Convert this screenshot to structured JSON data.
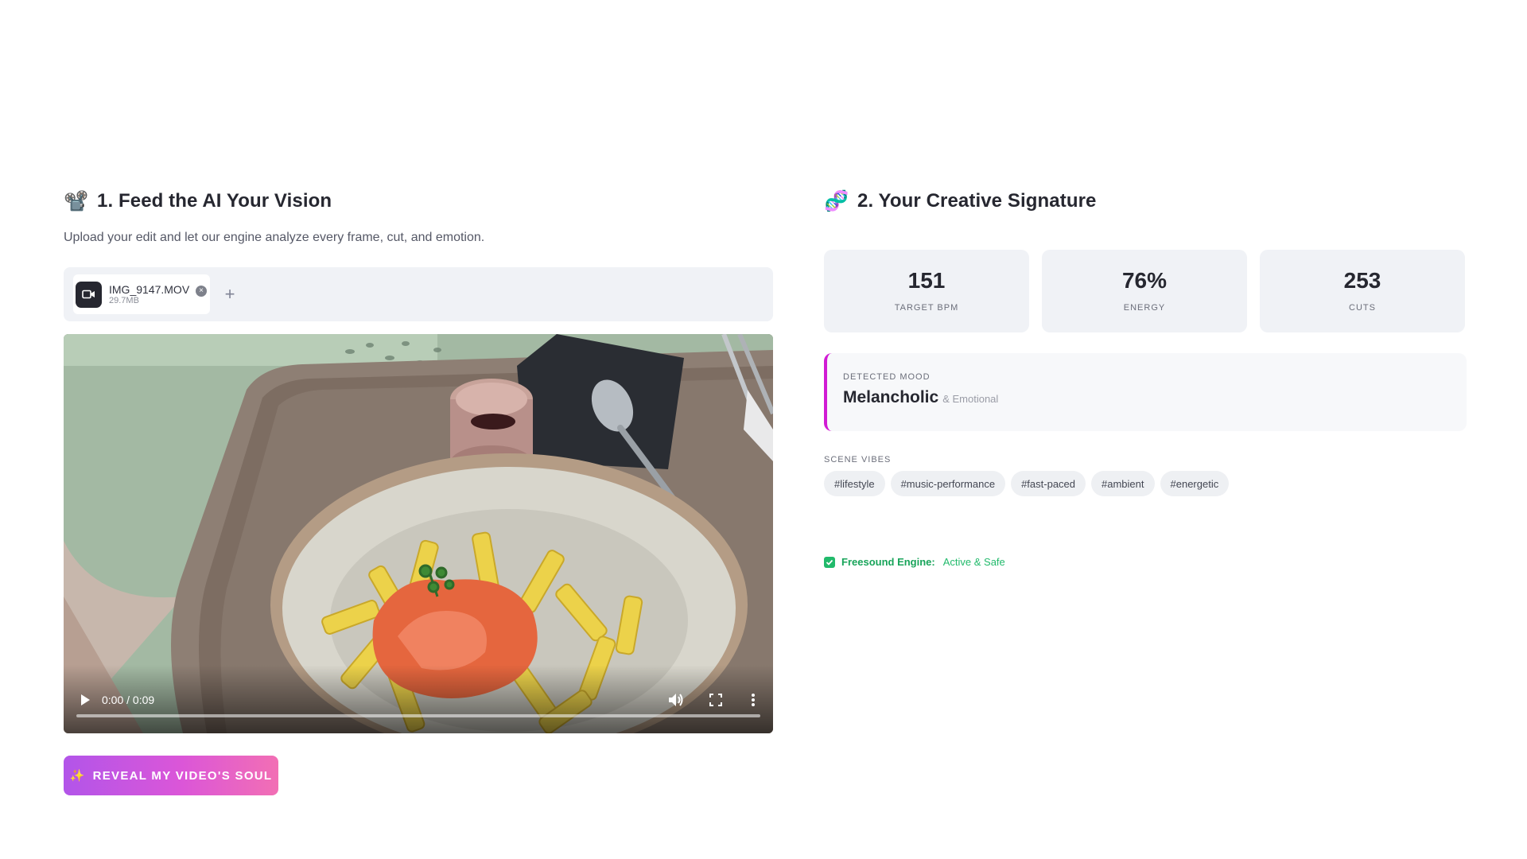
{
  "left": {
    "title_icon": "film-projector-icon",
    "title": "1. Feed the AI Your Vision",
    "subtitle": "Upload your edit and let our engine analyze every frame, cut, and emotion.",
    "uploader": {
      "file_name": "IMG_9147.MOV",
      "file_size": "29.7MB",
      "add_label": "+"
    },
    "video": {
      "time": "0:00 / 0:09",
      "progress": 0
    },
    "button": {
      "icon": "sparkles-icon",
      "label": "REVEAL MY VIDEO'S SOUL"
    }
  },
  "right": {
    "title_icon": "dna-icon",
    "title": "2. Your Creative Signature",
    "metrics": [
      {
        "value": "151",
        "label": "TARGET BPM"
      },
      {
        "value": "76%",
        "label": "ENERGY"
      },
      {
        "value": "253",
        "label": "CUTS"
      }
    ],
    "mood": {
      "label": "DETECTED MOOD",
      "value": "Melancholic",
      "sub": "& Emotional",
      "accent": "#d11bd4"
    },
    "vibes": {
      "label": "SCENE VIBES",
      "tags": [
        "#lifestyle",
        "#music-performance",
        "#fast-paced",
        "#ambient",
        "#energetic"
      ]
    },
    "engine": {
      "name": "Freesound Engine:",
      "status": "Active & Safe",
      "color": "#21ba6b"
    }
  },
  "colors": {
    "button_gradient_start": "#b255e9",
    "button_gradient_end": "#f26fb4",
    "card_bg": "#f0f2f6"
  }
}
